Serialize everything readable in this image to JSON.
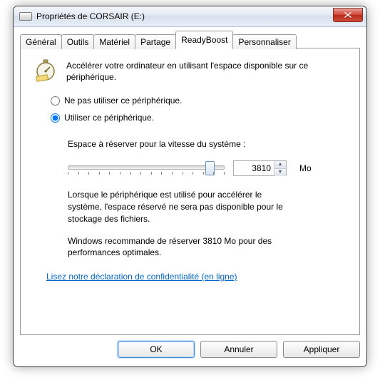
{
  "window": {
    "title": "Propriétés de CORSAIR (E:)"
  },
  "tabs": [
    {
      "label": "Général"
    },
    {
      "label": "Outils"
    },
    {
      "label": "Matériel"
    },
    {
      "label": "Partage"
    },
    {
      "label": "ReadyBoost"
    },
    {
      "label": "Personnaliser"
    }
  ],
  "active_tab": 4,
  "readyboost": {
    "intro": "Accélérer votre ordinateur en utilisant l'espace disponible sur ce périphérique.",
    "option_off": "Ne pas utiliser ce périphérique.",
    "option_on": "Utiliser ce périphérique.",
    "selected": "on",
    "reserve_label": "Espace à réserver pour la vitesse du système :",
    "reserve_value": "3810",
    "reserve_unit": "Mo",
    "slider_min": 0,
    "slider_max": 3810,
    "slider_pos_percent": 93,
    "note1": "Lorsque le périphérique est utilisé pour accélérer le système, l'espace réservé ne sera pas disponible pour le stockage des fichiers.",
    "note2": "Windows recommande de réserver 3810 Mo pour des performances optimales.",
    "privacy_link": "Lisez notre déclaration de confidentialité (en ligne)"
  },
  "buttons": {
    "ok": "OK",
    "cancel": "Annuler",
    "apply": "Appliquer"
  }
}
